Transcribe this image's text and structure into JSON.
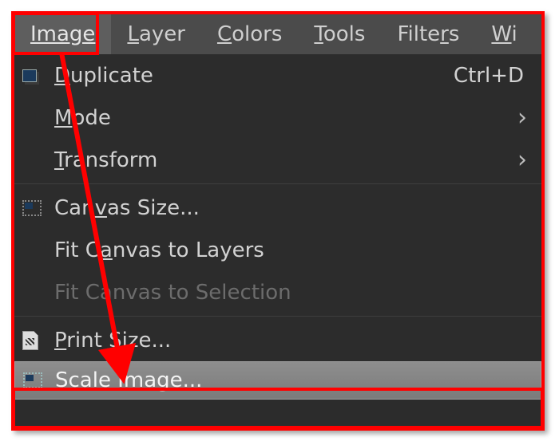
{
  "annotation": {
    "highlight_color": "#ff0000",
    "highlight_menu": "image",
    "highlight_item": "scale-image"
  },
  "menubar": {
    "image": {
      "label": "Image",
      "underline_index": 0
    },
    "layer": {
      "label": "Layer",
      "underline_index": 0
    },
    "colors": {
      "label": "Colors",
      "underline_index": 0
    },
    "tools": {
      "label": "Tools",
      "underline_index": 0
    },
    "filters": {
      "label": "Filters",
      "underline_index": 5
    },
    "windows": {
      "label": "Wi",
      "underline_index": 0
    }
  },
  "menu": {
    "duplicate": {
      "label": "Duplicate",
      "underline_index": 0,
      "shortcut": "Ctrl+D",
      "icon": "duplicate-icon"
    },
    "mode": {
      "label": "Mode",
      "underline_index": 0,
      "submenu": true
    },
    "transform": {
      "label": "Transform",
      "underline_index": 0,
      "submenu": true
    },
    "canvas_size": {
      "label": "Canvas Size...",
      "underline_index": 3,
      "icon": "canvas-icon"
    },
    "fit_layers": {
      "label": "Fit Canvas to Layers",
      "underline_index": 5
    },
    "fit_selection": {
      "label": "Fit Canvas to Selection",
      "disabled": true
    },
    "print_size": {
      "label": "Print Size...",
      "underline_index": 0,
      "icon": "print-icon"
    },
    "scale_image": {
      "label": "Scale Image...",
      "underline_index": 0,
      "icon": "scale-icon",
      "hover": true
    }
  }
}
